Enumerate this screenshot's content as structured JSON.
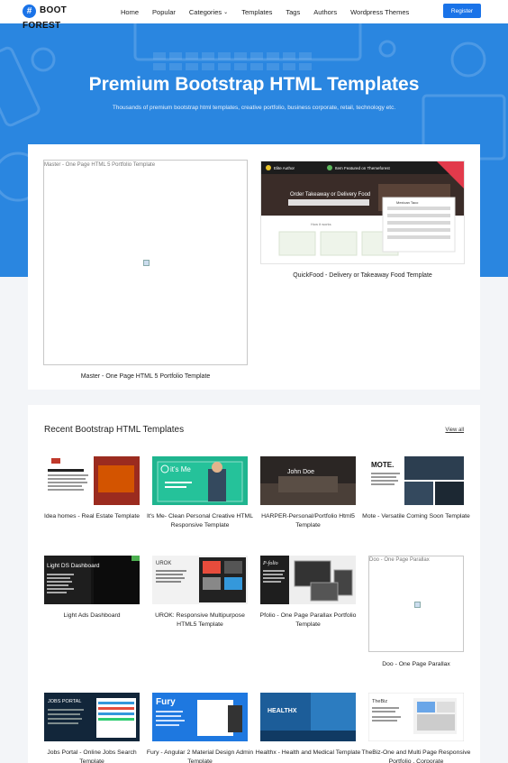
{
  "brand": {
    "line1": "BOOT",
    "line2": "FOREST",
    "badge": "#"
  },
  "nav": {
    "items": [
      "Home",
      "Popular",
      "Categories",
      "Templates",
      "Tags",
      "Authors",
      "Wordpress Themes"
    ],
    "register": "Register"
  },
  "hero": {
    "title": "Premium Bootstrap HTML Templates",
    "subtitle": "Thousands of premium bootstrap html templates, creative portfolio, business corporate, retail, technology etc."
  },
  "featured": [
    {
      "alt": "Master - One Page HTML 5 Portfolio Template",
      "caption": "Master - One Page HTML 5 Portfolio Template"
    },
    {
      "caption": "QuickFood - Delivery or Takeaway Food Template",
      "shot_text": [
        "Elite Author",
        "Item Featured on Themeforest",
        "Order Takeaway or Delivery Food",
        "How it works",
        "Mexican Taco"
      ]
    }
  ],
  "recent": {
    "title": "Recent Bootstrap HTML Templates",
    "view_all": "View all",
    "cards": [
      {
        "caption": "Idea homes - Real Estate Template"
      },
      {
        "caption": "It's Me- Clean Personal Creative HTML Responsive Template",
        "shot_text": "it's Me"
      },
      {
        "caption": "HARPER-Personal/Portfolio Html5 Template",
        "shot_text": "John Doe"
      },
      {
        "caption": "Mote - Versatile Coming Soon Template",
        "shot_text": "MOTE."
      },
      {
        "caption": "Light Ads Dashboard",
        "shot_text": "Light DS Dashboard"
      },
      {
        "caption": "UROK: Responsive Multipurpose HTML5 Template",
        "shot_text": "UROK"
      },
      {
        "caption": "Pfolio - One Page Parallax Portfolio Template",
        "shot_text": "P-folio"
      },
      {
        "caption": "Doo - One Page Parallax",
        "alt": "Doo - One Page Parallax"
      },
      {
        "caption": "Jobs Portal - Online Jobs Search Template",
        "shot_text": "JOBS PORTAL"
      },
      {
        "caption": "Fury - Angular 2 Material Design Admin Template",
        "shot_text": "Fury"
      },
      {
        "caption": "Healthx - Health and Medical Template",
        "shot_text": "HEALTHX"
      },
      {
        "caption": "TheBiz-One and Multi Page Responsive Portfolio , Corporate",
        "shot_text": "TheBiz"
      }
    ]
  },
  "colors": {
    "accent": "#1a73e8",
    "hero": "#2a86e0"
  }
}
